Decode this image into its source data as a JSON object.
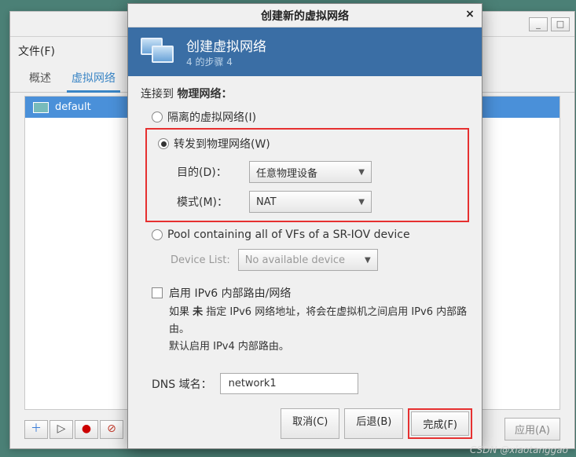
{
  "bg": {
    "menu_file": "文件(F)",
    "tab_overview": "概述",
    "tab_vnet": "虚拟网络",
    "row_default": "default",
    "apply": "应用(A)"
  },
  "dlg": {
    "title": "创建新的虚拟网络",
    "hdr_title": "创建虚拟网络",
    "hdr_step": "4 的步骤 4",
    "connect_label": "连接到",
    "connect_target": "物理网络：",
    "opt_isolated": "隔离的虚拟网络(I)",
    "opt_forward": "转发到物理网络(W)",
    "dest_label": "目的(D)：",
    "dest_value": "任意物理设备",
    "mode_label": "模式(M)：",
    "mode_value": "NAT",
    "opt_pool": "Pool containing all of VFs of a SR-IOV device",
    "devlist_label": "Device List:",
    "devlist_value": "No available device",
    "ipv6_chk": "启用 IPv6 内部路由/网络",
    "ipv6_desc1_a": "如果 ",
    "ipv6_desc1_b": "未",
    "ipv6_desc1_c": " 指定 IPv6 网络地址，将会在虚拟机之间启用 IPv6 内部路由。",
    "ipv6_desc2": "默认启用 IPv4 内部路由。",
    "dns_label": "DNS 域名：",
    "dns_value": "network1",
    "btn_cancel": "取消(C)",
    "btn_back": "后退(B)",
    "btn_finish": "完成(F)"
  },
  "watermark": "CSDN @xiaotanggao"
}
